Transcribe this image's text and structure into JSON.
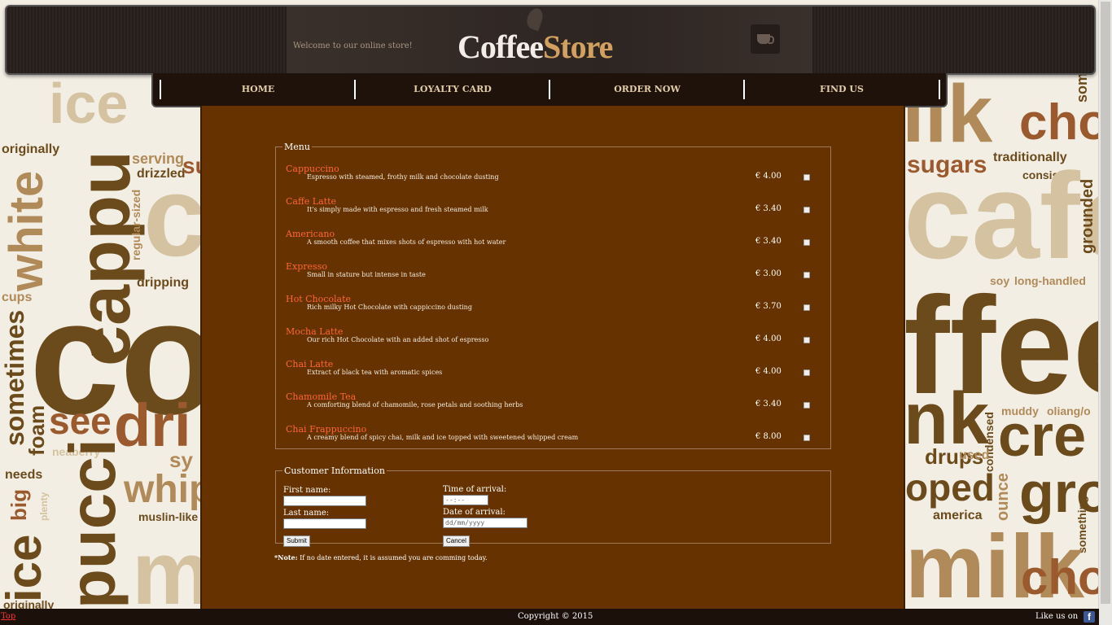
{
  "header": {
    "welcome": "Welcome to our online store!",
    "logo_coffee": "Coffee",
    "logo_store": "Store"
  },
  "nav": {
    "items": [
      "HOME",
      "LOYALTY CARD",
      "ORDER NOW",
      "FIND US"
    ]
  },
  "menu": {
    "legend": "Menu",
    "items": [
      {
        "name": "Cappuccino",
        "description": "Espresso with steamed, frothy milk and chocolate dusting",
        "price": "€ 4.00"
      },
      {
        "name": "Caffe Latte",
        "description": "It's simply made with espresso and fresh steamed milk",
        "price": "€ 3.40"
      },
      {
        "name": "Americano",
        "description": "A smooth coffee that mixes shots of espresso with hot water",
        "price": "€ 3.40"
      },
      {
        "name": "Expresso",
        "description": "Small in stature but intense in taste",
        "price": "€ 3.00"
      },
      {
        "name": "Hot Chocolate",
        "description": "Rich milky Hot Chocolate with cappiccino dusting",
        "price": "€ 3.70"
      },
      {
        "name": "Mocha Latte",
        "description": "Our rich Hot Chocolate with an added shot of espresso",
        "price": "€ 4.00"
      },
      {
        "name": "Chai Latte",
        "description": "Extract of black tea with aromatic spices",
        "price": "€ 4.00"
      },
      {
        "name": "Chamomile Tea",
        "description": "A comforting blend of chamomile, rose petals and soothing herbs",
        "price": "€ 3.40"
      },
      {
        "name": "Chai Frappuccino",
        "description": "A creamy blend of spicy chai, milk and ice topped with sweetened whipped cream",
        "price": "€ 8.00"
      }
    ]
  },
  "customer": {
    "legend": "Customer Information",
    "first_name_label": "First name:",
    "last_name_label": "Last name:",
    "time_label": "Time of arrival:",
    "time_placeholder": "--:--",
    "date_label": "Date of arrival:",
    "date_placeholder": "dd/mm/yyyy",
    "submit_label": "Submit",
    "cancel_label": "Cancel"
  },
  "note": {
    "prefix": "*Note:",
    "text": " If no date entered, it is assumed you are comming today."
  },
  "footer": {
    "top_link": "Top",
    "copyright": "Copyright © 2015",
    "like": "Like us on",
    "fb_icon": "f"
  },
  "background": {
    "words": [
      "originally",
      "white",
      "cappu",
      "ice",
      "c",
      "serving",
      "drizzled",
      "su",
      "regular-sized",
      "dripping",
      "cups",
      "sometimes",
      "co",
      "see",
      "dri",
      "foam",
      "neaberry",
      "needs",
      "big",
      "plenty",
      "pucci",
      "whip",
      "sy",
      "muslin-like",
      "m",
      "ice",
      "originally",
      "ilk",
      "cho",
      "some",
      "sugars",
      "traditionally",
      "consists",
      "cafe",
      "grounded",
      "soy",
      "long-handled",
      "ffee",
      "muddy",
      "oliang/o",
      "nk",
      "cre",
      "condensed",
      "drups",
      "used",
      "oped",
      "ounce",
      "gro",
      "america",
      "something",
      "milk",
      "cho"
    ]
  }
}
